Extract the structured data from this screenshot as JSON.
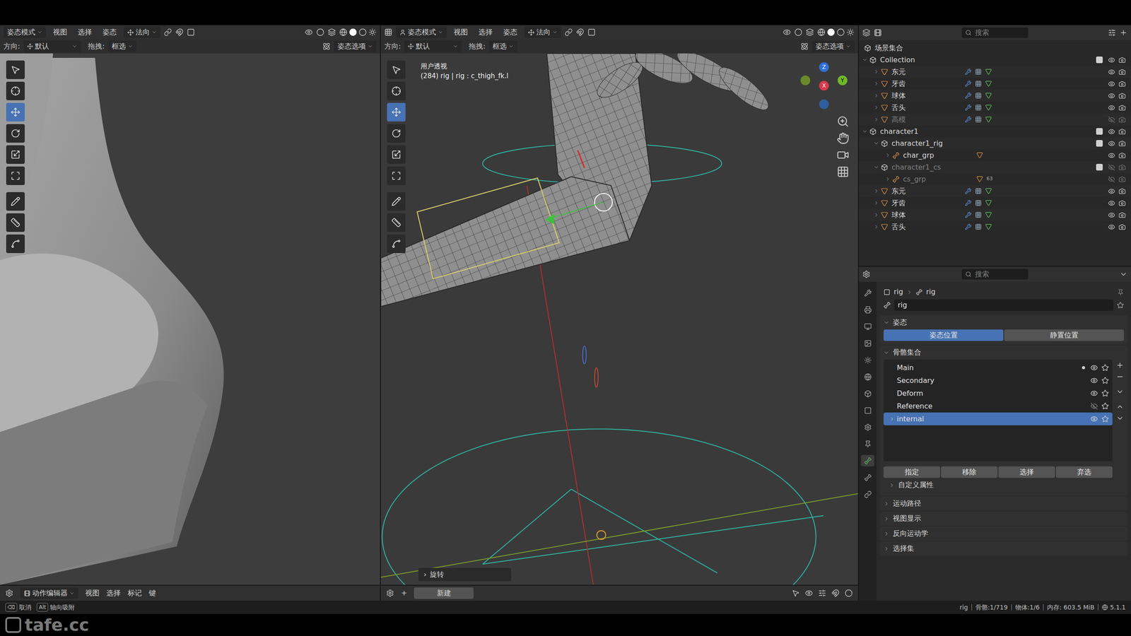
{
  "viewports": [
    {
      "mode": "姿态模式",
      "menus": [
        "视图",
        "选择",
        "姿态"
      ],
      "orientation": "法向",
      "direction_label": "方向:",
      "direction": "默认",
      "drag_label": "拖拽:",
      "drag": "框选",
      "options": "姿态选项",
      "overlay_lines": [],
      "last_op": null,
      "gizmo": []
    },
    {
      "mode": "姿态模式",
      "menus": [
        "视图",
        "选择",
        "姿态"
      ],
      "orientation": "法向",
      "direction_label": "方向:",
      "direction": "默认",
      "drag_label": "拖拽:",
      "drag": "框选",
      "options": "姿态选项",
      "overlay_lines": [
        "用户透视",
        "(284) rig | rig : c_thigh_fk.l"
      ],
      "last_op": {
        "toggle": "›",
        "label": "旋转"
      },
      "gizmo": [
        "Z",
        "X",
        "Y"
      ]
    }
  ],
  "bottom_bars": [
    {
      "editor": "动作编辑器",
      "menus": [
        "视图",
        "选择",
        "标记",
        "键"
      ]
    },
    {
      "add": "+",
      "new": "新建"
    }
  ],
  "outliner": {
    "search": "搜索",
    "root": "场景集合",
    "rows": [
      {
        "label": "Collection",
        "depth": 0,
        "kind": "collection",
        "expanded": true,
        "hidden": false,
        "badge": ""
      },
      {
        "label": "东元",
        "depth": 1,
        "kind": "object",
        "expanded": false,
        "hidden": false,
        "badge": ""
      },
      {
        "label": "牙齿",
        "depth": 1,
        "kind": "object",
        "expanded": false,
        "hidden": false,
        "badge": ""
      },
      {
        "label": "球体",
        "depth": 1,
        "kind": "object",
        "expanded": false,
        "hidden": false,
        "badge": ""
      },
      {
        "label": "舌头",
        "depth": 1,
        "kind": "object",
        "expanded": false,
        "hidden": false,
        "badge": ""
      },
      {
        "label": "高模",
        "depth": 1,
        "kind": "object",
        "expanded": false,
        "hidden": true,
        "badge": ""
      },
      {
        "label": "character1",
        "depth": 0,
        "kind": "collection",
        "expanded": true,
        "hidden": false,
        "badge": ""
      },
      {
        "label": "character1_rig",
        "depth": 1,
        "kind": "collection",
        "expanded": true,
        "hidden": false,
        "badge": ""
      },
      {
        "label": "char_grp",
        "depth": 2,
        "kind": "armature",
        "expanded": false,
        "hidden": false,
        "badge": ""
      },
      {
        "label": "character1_cs",
        "depth": 1,
        "kind": "collection",
        "expanded": true,
        "hidden": true,
        "badge": ""
      },
      {
        "label": "cs_grp",
        "depth": 2,
        "kind": "armature",
        "expanded": false,
        "hidden": true,
        "badge": "63"
      },
      {
        "label": "东元",
        "depth": 1,
        "kind": "object",
        "expanded": false,
        "hidden": false,
        "badge": ""
      },
      {
        "label": "牙齿",
        "depth": 1,
        "kind": "object",
        "expanded": false,
        "hidden": false,
        "badge": ""
      },
      {
        "label": "球体",
        "depth": 1,
        "kind": "object",
        "expanded": false,
        "hidden": false,
        "badge": ""
      },
      {
        "label": "舌头",
        "depth": 1,
        "kind": "object",
        "expanded": false,
        "hidden": false,
        "badge": ""
      }
    ]
  },
  "properties": {
    "search": "搜索",
    "breadcrumb": [
      "rig",
      "rig"
    ],
    "name": "rig",
    "pose": {
      "title": "姿态",
      "expanded": true,
      "buttons": [
        {
          "label": "姿态位置",
          "selected": true
        },
        {
          "label": "静置位置",
          "selected": false
        }
      ]
    },
    "bone_collections": {
      "title": "骨骼集合",
      "expanded": true,
      "items": [
        {
          "name": "Main",
          "visible": true,
          "active": true,
          "selected": false,
          "expandable": false
        },
        {
          "name": "Secondary",
          "visible": true,
          "active": false,
          "selected": false,
          "expandable": false
        },
        {
          "name": "Deform",
          "visible": true,
          "active": false,
          "selected": false,
          "expandable": false
        },
        {
          "name": "Reference",
          "visible": false,
          "active": false,
          "selected": false,
          "expandable": false
        },
        {
          "name": "internal",
          "visible": true,
          "active": false,
          "selected": true,
          "expandable": true
        }
      ],
      "buttons": [
        "指定",
        "移除",
        "选择",
        "弃选"
      ],
      "custom": "自定义属性"
    },
    "sections": [
      {
        "title": "运动路径",
        "expanded": false
      },
      {
        "title": "视图显示",
        "expanded": false
      },
      {
        "title": "反向运动学",
        "expanded": false
      },
      {
        "title": "选择集",
        "expanded": false
      }
    ]
  },
  "status_bar": {
    "hints": [
      {
        "key": "⌫",
        "label": "取消"
      },
      {
        "key": "Alt",
        "label": "轴向吸附"
      }
    ],
    "stats": [
      "rig",
      "骨骼:1/719",
      "物体:1/6",
      "内存: 603.5 MiB",
      "5.1.1"
    ]
  },
  "watermark": "tafe.cc"
}
